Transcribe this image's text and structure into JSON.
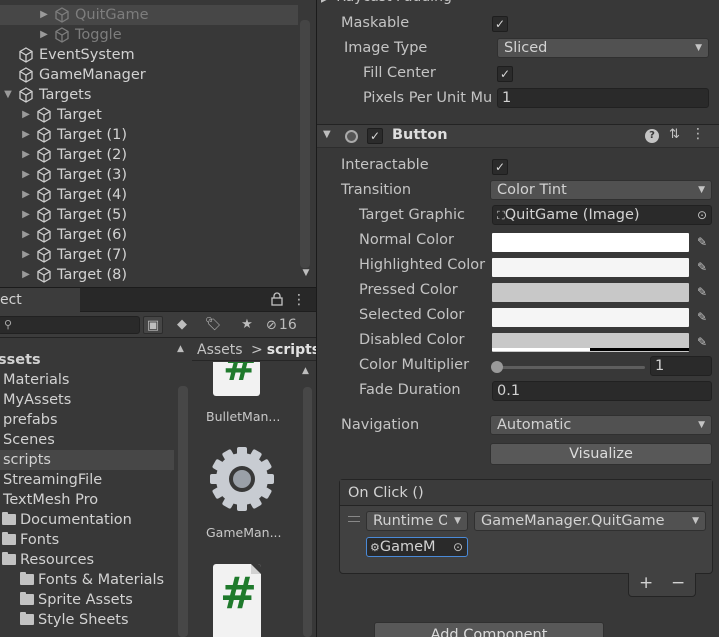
{
  "hierarchy": {
    "items": [
      {
        "label": "QuitGame",
        "depth": 2,
        "expand": true,
        "selected": true,
        "dim": true
      },
      {
        "label": "Toggle",
        "depth": 2,
        "expand": true,
        "dim": true
      },
      {
        "label": "EventSystem",
        "depth": 0,
        "expand": false
      },
      {
        "label": "GameManager",
        "depth": 0,
        "expand": false
      },
      {
        "label": "Targets",
        "depth": 0,
        "expand": true,
        "open": true
      },
      {
        "label": "Target",
        "depth": 1,
        "expand": true
      },
      {
        "label": "Target (1)",
        "depth": 1,
        "expand": true
      },
      {
        "label": "Target (2)",
        "depth": 1,
        "expand": true
      },
      {
        "label": "Target (3)",
        "depth": 1,
        "expand": true
      },
      {
        "label": "Target (4)",
        "depth": 1,
        "expand": true
      },
      {
        "label": "Target (5)",
        "depth": 1,
        "expand": true
      },
      {
        "label": "Target (6)",
        "depth": 1,
        "expand": true
      },
      {
        "label": "Target (7)",
        "depth": 1,
        "expand": true
      },
      {
        "label": "Target (8)",
        "depth": 1,
        "expand": true
      }
    ]
  },
  "project": {
    "tab": "ect",
    "hidden_count": "16",
    "tree": [
      {
        "label": "ssets",
        "type": "root"
      },
      {
        "label": "Materials",
        "type": "item"
      },
      {
        "label": "MyAssets",
        "type": "item"
      },
      {
        "label": "prefabs",
        "type": "item"
      },
      {
        "label": "Scenes",
        "type": "item"
      },
      {
        "label": "scripts",
        "type": "item",
        "selected": true
      },
      {
        "label": "StreamingFile",
        "type": "item"
      },
      {
        "label": "TextMesh Pro",
        "type": "item"
      },
      {
        "label": "Documentation",
        "type": "folder"
      },
      {
        "label": "Fonts",
        "type": "folder"
      },
      {
        "label": "Resources",
        "type": "folder"
      },
      {
        "label": "Fonts & Materials",
        "type": "subfolder"
      },
      {
        "label": "Sprite Assets",
        "type": "subfolder"
      },
      {
        "label": "Style Sheets",
        "type": "subfolder"
      }
    ],
    "breadcrumb": {
      "root": "Assets",
      "sep": ">",
      "current": "scripts"
    },
    "assets": [
      {
        "label": "BulletMan..."
      },
      {
        "label": "GameMan..."
      }
    ]
  },
  "inspector": {
    "maskable": {
      "label": "Maskable"
    },
    "image_type": {
      "label": "Image Type",
      "value": "Sliced"
    },
    "fill_center": {
      "label": "Fill Center"
    },
    "ppu": {
      "label": "Pixels Per Unit Mu",
      "value": "1"
    },
    "component": {
      "title": "Button"
    },
    "interactable": {
      "label": "Interactable"
    },
    "transition": {
      "label": "Transition",
      "value": "Color Tint"
    },
    "target_graphic": {
      "label": "Target Graphic",
      "value": "QuitGame (Image)"
    },
    "colors": [
      {
        "label": "Normal Color",
        "color": "#ffffff"
      },
      {
        "label": "Highlighted Color",
        "color": "#f5f5f5"
      },
      {
        "label": "Pressed Color",
        "color": "#c8c8c8"
      },
      {
        "label": "Selected Color",
        "color": "#f5f5f5"
      },
      {
        "label": "Disabled Color",
        "color": "#c8c8c8"
      }
    ],
    "color_multiplier": {
      "label": "Color Multiplier",
      "value": "1",
      "fraction": 0
    },
    "fade_duration": {
      "label": "Fade Duration",
      "value": "0.1"
    },
    "navigation": {
      "label": "Navigation",
      "value": "Automatic"
    },
    "visualize": "Visualize",
    "onclick": {
      "title": "On Click ()",
      "runtime": "Runtime Or",
      "function": "GameManager.QuitGame",
      "object": "GameM"
    },
    "plus": "+",
    "minus": "−",
    "add_component": "Add Component"
  }
}
